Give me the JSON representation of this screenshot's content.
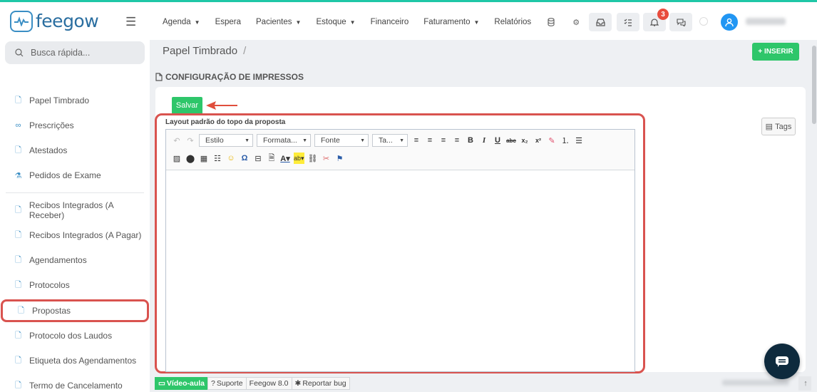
{
  "app": {
    "logo_text": "feegow",
    "accent_color": "#1fc7a7",
    "brand_color": "#2a6ea0"
  },
  "nav": {
    "items": [
      {
        "label": "Agenda",
        "dropdown": true
      },
      {
        "label": "Espera",
        "dropdown": false
      },
      {
        "label": "Pacientes",
        "dropdown": true
      },
      {
        "label": "Estoque",
        "dropdown": true
      },
      {
        "label": "Financeiro",
        "dropdown": false
      },
      {
        "label": "Faturamento",
        "dropdown": true
      },
      {
        "label": "Relatórios",
        "dropdown": false
      }
    ],
    "notification_count": "3"
  },
  "search": {
    "placeholder": "Busca rápida..."
  },
  "sidebar": {
    "items": [
      {
        "label": "Papel Timbrado",
        "icon": "document-icon"
      },
      {
        "label": "Prescrições",
        "icon": "glasses-icon"
      },
      {
        "label": "Atestados",
        "icon": "document-plus-icon"
      },
      {
        "label": "Pedidos de Exame",
        "icon": "flask-icon"
      },
      {
        "label": "Recibos Integrados (A Receber)",
        "icon": "document-icon"
      },
      {
        "label": "Recibos Integrados (A Pagar)",
        "icon": "document-icon"
      },
      {
        "label": "Agendamentos",
        "icon": "document-icon"
      },
      {
        "label": "Protocolos",
        "icon": "document-icon"
      },
      {
        "label": "Propostas",
        "icon": "document-icon",
        "active": true
      },
      {
        "label": "Protocolo dos Laudos",
        "icon": "document-icon"
      },
      {
        "label": "Etiqueta dos Agendamentos",
        "icon": "document-icon"
      },
      {
        "label": "Termo de Cancelamento",
        "icon": "document-icon"
      }
    ]
  },
  "page": {
    "breadcrumb": "Papel Timbrado",
    "breadcrumb_sep": "/",
    "insert_label": "+ INSERIR",
    "section_title": "CONFIGURAÇÃO DE IMPRESSOS",
    "save_label": "Salvar",
    "field_label": "Layout padrão do topo da proposta",
    "tags_label": "Tags"
  },
  "editor": {
    "style_combo": "Estilo",
    "format_combo": "Formata...",
    "font_combo": "Fonte",
    "size_combo": "Ta...",
    "content": ""
  },
  "footer": {
    "video_label": "Vídeo-aula",
    "support_label": "Suporte",
    "version_label": "Feegow 8.0",
    "bug_label": "Reportar bug"
  },
  "colors": {
    "green": "#2ec66a",
    "highlight_red": "#d9534f",
    "badge_red": "#e84c3d"
  }
}
